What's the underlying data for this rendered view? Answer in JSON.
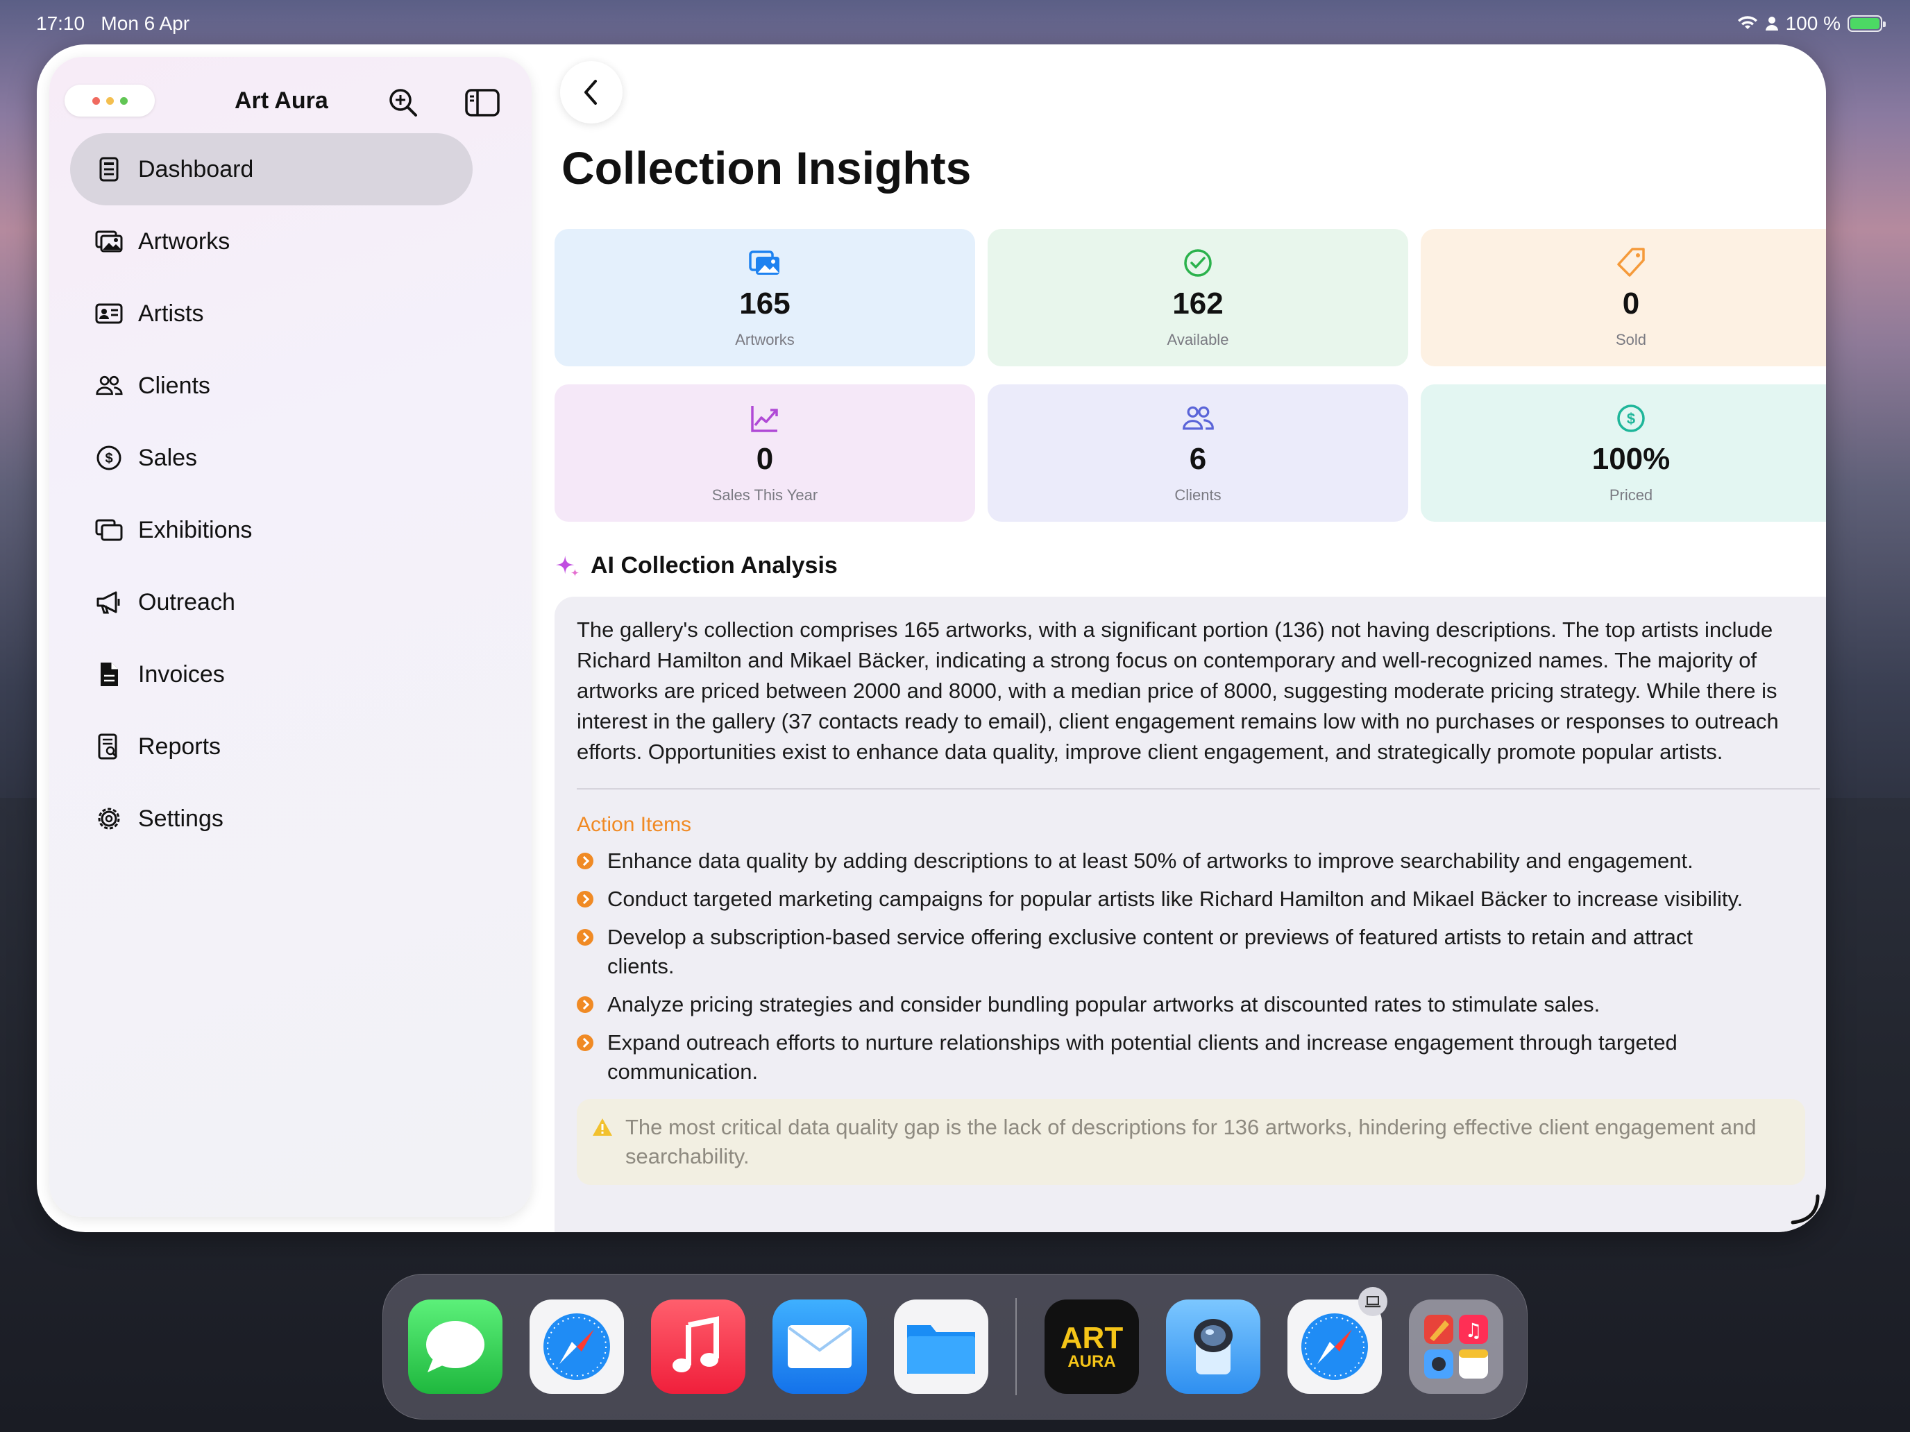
{
  "status_bar": {
    "time": "17:10",
    "date": "Mon 6 Apr",
    "battery": "100 %"
  },
  "sidebar": {
    "app_title": "Art Aura",
    "items": [
      {
        "label": "Dashboard",
        "icon": "dashboard-icon",
        "active": true
      },
      {
        "label": "Artworks",
        "icon": "photos-icon"
      },
      {
        "label": "Artists",
        "icon": "person-card-icon"
      },
      {
        "label": "Clients",
        "icon": "people-icon"
      },
      {
        "label": "Sales",
        "icon": "dollar-circle-icon"
      },
      {
        "label": "Exhibitions",
        "icon": "rectangles-icon"
      },
      {
        "label": "Outreach",
        "icon": "megaphone-icon"
      },
      {
        "label": "Invoices",
        "icon": "document-icon"
      },
      {
        "label": "Reports",
        "icon": "report-search-icon"
      },
      {
        "label": "Settings",
        "icon": "gear-icon"
      }
    ]
  },
  "main": {
    "title": "Collection Insights",
    "stats": [
      {
        "value": "165",
        "label": "Artworks",
        "icon": "photos-icon",
        "color": "#1e82f0",
        "bg": "#e4f0fc"
      },
      {
        "value": "162",
        "label": "Available",
        "icon": "checkmark-circle-icon",
        "color": "#2bb24c",
        "bg": "#e8f6ec"
      },
      {
        "value": "0",
        "label": "Sold",
        "icon": "tag-icon",
        "color": "#f59a3a",
        "bg": "#fdf1e3"
      },
      {
        "value": "0",
        "label": "Sales This Year",
        "icon": "chart-up-icon",
        "color": "#b04ad6",
        "bg": "#f5e8f8"
      },
      {
        "value": "6",
        "label": "Clients",
        "icon": "people-icon",
        "color": "#5a64d8",
        "bg": "#ebebfa"
      },
      {
        "value": "100%",
        "label": "Priced",
        "icon": "dollar-circle-icon",
        "color": "#1fb69a",
        "bg": "#e3f6f2"
      }
    ],
    "ai": {
      "heading": "AI Collection Analysis",
      "summary": "The gallery's collection comprises 165 artworks, with a significant portion (136) not having descriptions. The top artists include Richard Hamilton and Mikael Bäcker, indicating a strong focus on contemporary and well-recognized names. The majority of artworks are priced between 2000 and 8000, with a median price of 8000, suggesting moderate pricing strategy. While there is interest in the gallery (37 contacts ready to email), client engagement remains low with no purchases or responses to outreach efforts. Opportunities exist to enhance data quality, improve client engagement, and strategically promote popular artists.",
      "action_title": "Action Items",
      "actions": [
        "Enhance data quality by adding descriptions to at least 50% of artworks to improve searchability and engagement.",
        "Conduct targeted marketing campaigns for popular artists like Richard Hamilton and Mikael Bäcker to increase visibility.",
        "Develop a subscription-based service offering exclusive content or previews of featured artists to retain and attract clients.",
        "Analyze pricing strategies and consider bundling popular artworks at discounted rates to stimulate sales.",
        "Expand outreach efforts to nurture relationships with potential clients and increase engagement through targeted communication."
      ],
      "warning": "The most critical data quality gap is the lack of descriptions for 136 artworks, hindering effective client engagement and searchability."
    }
  },
  "dock": {
    "apps": [
      "Messages",
      "Safari",
      "Music",
      "Mail",
      "Files",
      "Art Aura",
      "Preview",
      "Safari",
      "Folder"
    ],
    "art_aura_logo": {
      "line1": "ART",
      "line2": "AURA"
    }
  }
}
